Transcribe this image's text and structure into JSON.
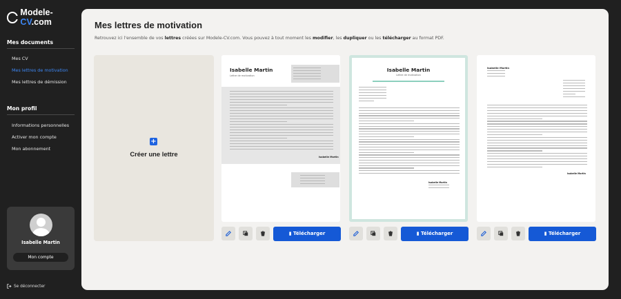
{
  "app": {
    "logo_text": "Modele-",
    "logo_accent": "CV",
    "logo_suffix": ".com",
    "accent_color": "#3d87f5",
    "button_color": "#1559d6"
  },
  "sidebar": {
    "documents_heading": "Mes documents",
    "documents_items": [
      "Mes CV",
      "Mes lettres de motivation",
      "Mes lettres de démission"
    ],
    "active_item": "Mes lettres de motivation",
    "profile_heading": "Mon profil",
    "profile_items": [
      "Informations personnelles",
      "Activer mon compte",
      "Mon abonnement"
    ],
    "user_name": "Isabelle Martin",
    "account_button": "Mon compte",
    "logout": "Se déconnecter"
  },
  "main": {
    "title": "Mes lettres de motivation",
    "subtitle_parts": [
      "Retrouvez ici l'ensemble de vos ",
      "lettres",
      " créées sur Modele-CV.com. Vous pouvez à tout moment les ",
      "modifier",
      ", les ",
      "dupliquer",
      " ou les ",
      "télécharger",
      " au format PDF."
    ],
    "create_label": "Créer une lettre",
    "download_label": "Télécharger",
    "letters": [
      {
        "name": "Isabelle Martin",
        "subtitle": "Lettre de motivation",
        "signature": "Isabelle Martin"
      },
      {
        "name": "Isabelle Martin",
        "subtitle": "Lettre de motivation",
        "signature": "Isabelle Martin"
      },
      {
        "name": "Isabelle Martin",
        "subtitle": "",
        "signature": "Isabelle Martin"
      }
    ]
  }
}
